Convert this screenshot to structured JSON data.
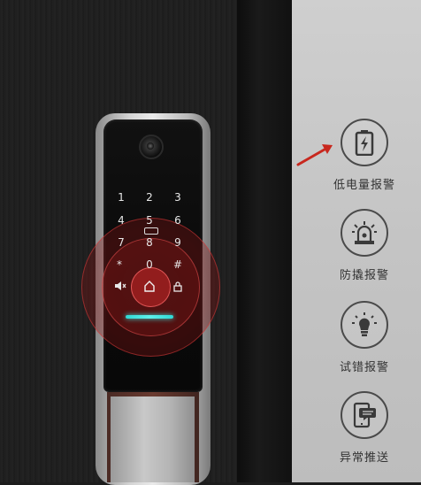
{
  "keypad": {
    "rows": [
      [
        "1",
        "2",
        "3"
      ],
      [
        "4",
        "5",
        "6"
      ],
      [
        "7",
        "8",
        "9"
      ],
      [
        "*",
        "0",
        "#"
      ]
    ]
  },
  "features": [
    {
      "label": "低电量报警",
      "icon": "battery-icon"
    },
    {
      "label": "防撬报警",
      "icon": "siren-icon"
    },
    {
      "label": "试错报警",
      "icon": "lightbulb-icon"
    },
    {
      "label": "异常推送",
      "icon": "phone-message-icon"
    }
  ],
  "colors": {
    "accent_red": "#c8281e",
    "indicator_cyan": "#39e3dd",
    "icon_dark": "#3a3a3a"
  }
}
